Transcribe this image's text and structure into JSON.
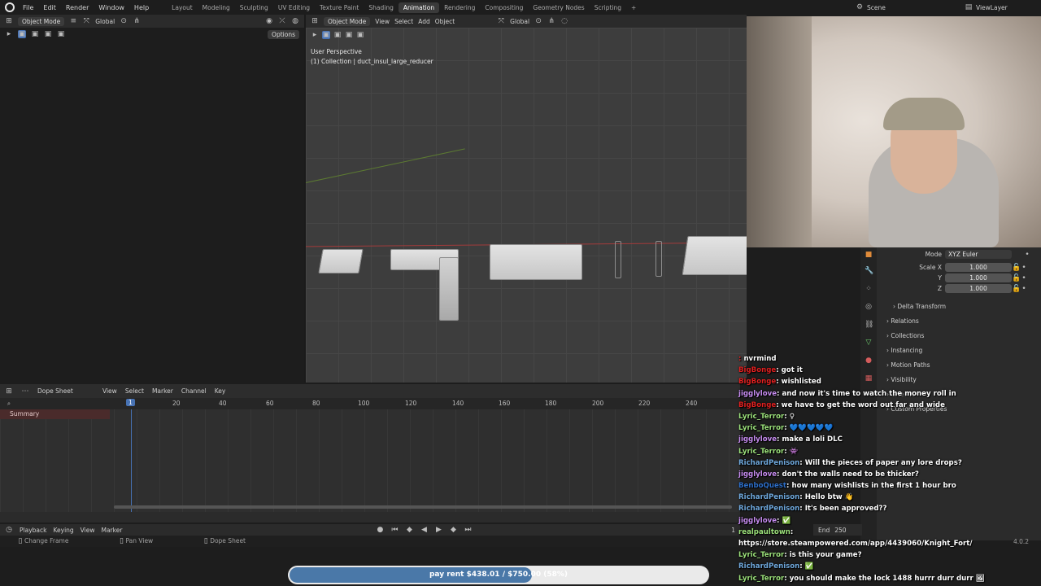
{
  "menu": {
    "items": [
      "File",
      "Edit",
      "Render",
      "Window",
      "Help"
    ]
  },
  "workspaces": {
    "tabs": [
      "Layout",
      "Modeling",
      "Sculpting",
      "UV Editing",
      "Texture Paint",
      "Shading",
      "Animation",
      "Rendering",
      "Compositing",
      "Geometry Nodes",
      "Scripting"
    ],
    "active": "Animation"
  },
  "scene": {
    "name": "Scene",
    "viewlayer": "ViewLayer"
  },
  "left_viewport": {
    "mode": "Object Mode",
    "orientation": "Global",
    "options": "Options"
  },
  "main_viewport": {
    "mode": "Object Mode",
    "menus": [
      "View",
      "Select",
      "Add",
      "Object"
    ],
    "orientation": "Global",
    "perspective": "User Perspective",
    "collection": "(1) Collection | duct_insul_large_reducer"
  },
  "dopesheet": {
    "editor": "Dope Sheet",
    "menus": [
      "View",
      "Select",
      "Marker",
      "Channel",
      "Key"
    ],
    "ticks": [
      "20",
      "40",
      "60",
      "80",
      "100",
      "120",
      "140",
      "160",
      "180",
      "200",
      "220",
      "240"
    ],
    "current_frame": "1",
    "summary": "Summary"
  },
  "timeline": {
    "menus": [
      "Playback",
      "Keying",
      "View",
      "Marker"
    ],
    "frame": "1",
    "end_label": "End",
    "end": "250"
  },
  "statusbar": {
    "items": [
      "Change Frame",
      "Pan View",
      "Dope Sheet"
    ],
    "version": "4.0.2"
  },
  "properties": {
    "mode_label": "Mode",
    "mode_value": "XYZ Euler",
    "scale_label": "Scale X",
    "y_label": "Y",
    "z_label": "Z",
    "scale_x": "1.000",
    "scale_y": "1.000",
    "scale_z": "1.000",
    "sections": [
      "Delta Transform",
      "Relations",
      "Collections",
      "Instancing",
      "Motion Paths",
      "Visibility",
      "Line Art",
      "Custom Properties"
    ]
  },
  "chat": [
    {
      "user": "",
      "text": "nvrmind",
      "color": "#e02020"
    },
    {
      "user": "BigBonge",
      "text": "got it",
      "color": "#e02020"
    },
    {
      "user": "BigBonge",
      "text": "wishlisted",
      "color": "#e02020"
    },
    {
      "user": "jigglylove",
      "text": "and now it's time to watch the money roll in",
      "color": "#c68cf0"
    },
    {
      "user": "BigBonge",
      "text": "we have to get the word out far and wide",
      "color": "#e02020"
    },
    {
      "user": "Lyric_Terror",
      "text": "♀",
      "color": "#9be07a"
    },
    {
      "user": "Lyric_Terror",
      "text": "💙💙💙💙💙",
      "color": "#9be07a"
    },
    {
      "user": "jigglylove",
      "text": "make a loli DLC",
      "color": "#c68cf0"
    },
    {
      "user": "Lyric_Terror",
      "text": "👾",
      "color": "#9be07a"
    },
    {
      "user": "RichardPenison",
      "text": "Will the pieces of paper any lore drops?",
      "color": "#6fa8dc"
    },
    {
      "user": "jigglylove",
      "text": "don't the walls need to be thicker?",
      "color": "#c68cf0"
    },
    {
      "user": "BenboQuest",
      "text": "how many wishlists in the first 1 hour bro",
      "color": "#2d6ec8"
    },
    {
      "user": "RichardPenison",
      "text": "Hello btw 👋",
      "color": "#6fa8dc"
    },
    {
      "user": "RichardPenison",
      "text": "It's been approved??",
      "color": "#6fa8dc"
    },
    {
      "user": "jigglylove",
      "text": "✅",
      "color": "#c68cf0"
    },
    {
      "user": "realpaultown",
      "text": "",
      "color": "#9be07a"
    },
    {
      "user": "",
      "text": "https://store.steampowered.com/app/4439060/Knight_Fort/",
      "color": "#ffffff"
    },
    {
      "user": "Lyric_Terror",
      "text": "is this your game?",
      "color": "#9be07a"
    },
    {
      "user": "RichardPenison",
      "text": "✅",
      "color": "#6fa8dc"
    },
    {
      "user": "Lyric_Terror",
      "text": "you should make the lock 1488 hurrr durr durr 🖼",
      "color": "#9be07a"
    }
  ],
  "rent": {
    "label": "pay rent $438.01 / $750.00 (58%)",
    "fraction": 0.58
  }
}
